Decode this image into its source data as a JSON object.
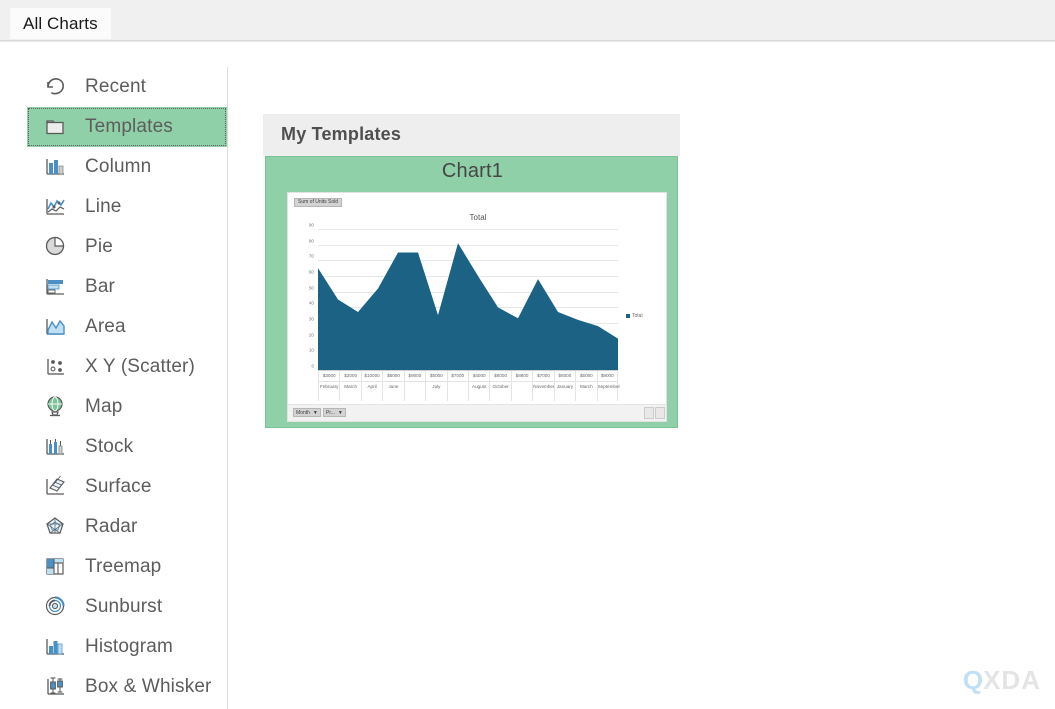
{
  "window": {
    "tab_label": "All Charts"
  },
  "sidebar": {
    "items": [
      {
        "label": "Recent",
        "icon": "recent-undo-icon",
        "selected": false
      },
      {
        "label": "Templates",
        "icon": "folder-icon",
        "selected": true
      },
      {
        "label": "Column",
        "icon": "column-chart-icon",
        "selected": false
      },
      {
        "label": "Line",
        "icon": "line-chart-icon",
        "selected": false
      },
      {
        "label": "Pie",
        "icon": "pie-chart-icon",
        "selected": false
      },
      {
        "label": "Bar",
        "icon": "bar-chart-icon",
        "selected": false
      },
      {
        "label": "Area",
        "icon": "area-chart-icon",
        "selected": false
      },
      {
        "label": "X Y (Scatter)",
        "icon": "scatter-chart-icon",
        "selected": false
      },
      {
        "label": "Map",
        "icon": "globe-map-icon",
        "selected": false
      },
      {
        "label": "Stock",
        "icon": "stock-chart-icon",
        "selected": false
      },
      {
        "label": "Surface",
        "icon": "surface-chart-icon",
        "selected": false
      },
      {
        "label": "Radar",
        "icon": "radar-chart-icon",
        "selected": false
      },
      {
        "label": "Treemap",
        "icon": "treemap-icon",
        "selected": false
      },
      {
        "label": "Sunburst",
        "icon": "sunburst-icon",
        "selected": false
      },
      {
        "label": "Histogram",
        "icon": "histogram-icon",
        "selected": false
      },
      {
        "label": "Box & Whisker",
        "icon": "box-whisker-icon",
        "selected": false
      }
    ]
  },
  "panel": {
    "header_title": "My Templates",
    "template": {
      "name": "Chart1",
      "selected": true
    }
  },
  "preview": {
    "pivot_field_button": "Sum of Units Sold",
    "slicer_buttons": [
      {
        "label": "Month",
        "caret": "▼"
      },
      {
        "label": "Pr...",
        "caret": "▼"
      }
    ]
  },
  "colors": {
    "selection_green": "#8fd0a8",
    "series_blue": "#1b6284",
    "panel_header_grey": "#eeeeee",
    "label_grey": "#5d5d5d"
  },
  "watermark": {
    "mark": "Q",
    "text": "XDA"
  },
  "chart_data": {
    "type": "area",
    "title": "Total",
    "xlabel": "",
    "ylabel": "",
    "ylim": [
      0,
      90
    ],
    "yticks": [
      0,
      10,
      20,
      30,
      40,
      50,
      60,
      70,
      80,
      90
    ],
    "grid": true,
    "legend": [
      "Total"
    ],
    "legend_position": "right",
    "field_button": "Sum of Units Sold",
    "categories": [
      "February",
      "March",
      "April",
      "June",
      "June",
      "July",
      "July",
      "August",
      "October",
      "October",
      "November",
      "January",
      "March",
      "September"
    ],
    "category_values": [
      "$3000",
      "$2000",
      "$10000",
      "$6000",
      "$9000",
      "$5000",
      "$7000",
      "$4000",
      "$6000",
      "$8800",
      "$7000",
      "$6000",
      "$5000",
      "$9000"
    ],
    "x_axis_rows": [
      {
        "name": "amount",
        "labels": [
          "$3000",
          "$2000",
          "$10000",
          "$6000",
          "$9000",
          "$5000",
          "$7000",
          "$4000",
          "$6000",
          "$8800",
          "$7000",
          "$6000",
          "$5000",
          "$9000"
        ]
      },
      {
        "name": "month",
        "labels": [
          "February",
          "March",
          "April",
          "June",
          "",
          "July",
          "",
          "August",
          "October",
          "",
          "November",
          "January",
          "March",
          "September"
        ]
      }
    ],
    "series": [
      {
        "name": "Total",
        "color": "#1b6284",
        "values": [
          65,
          45,
          37,
          52,
          75,
          75,
          35,
          81,
          60,
          40,
          33,
          58,
          37,
          32,
          28,
          20
        ]
      }
    ]
  }
}
